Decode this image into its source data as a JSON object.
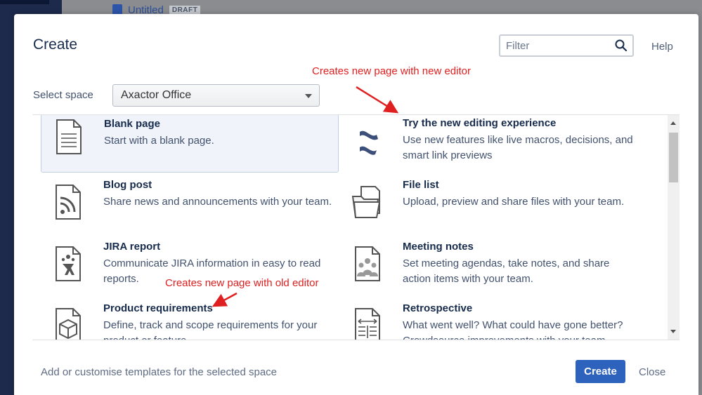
{
  "background": {
    "page_title": "Untitled",
    "page_badge": "DRAFT"
  },
  "dialog": {
    "title": "Create",
    "filter_placeholder": "Filter",
    "help_label": "Help",
    "select_space_label": "Select space",
    "selected_space": "Axactor Office",
    "templates": [
      {
        "name": "Blank page",
        "description": "Start with a blank page.",
        "icon": "blank-page-icon",
        "selected": true
      },
      {
        "name": "Try the new editing experience",
        "description": "Use new features like live macros, decisions, and smart link previews",
        "icon": "confluence-logo-icon"
      },
      {
        "name": "Blog post",
        "description": "Share news and announcements with your team.",
        "icon": "rss-icon"
      },
      {
        "name": "File list",
        "description": "Upload, preview and share files with your team.",
        "icon": "folder-icon"
      },
      {
        "name": "JIRA report",
        "description": "Communicate JIRA information in easy to read reports.",
        "icon": "jira-report-icon"
      },
      {
        "name": "Meeting notes",
        "description": "Set meeting agendas, take notes, and share action items with your team.",
        "icon": "meeting-notes-icon"
      },
      {
        "name": "Product requirements",
        "description": "Define, track and scope requirements for your product or feature.",
        "icon": "product-box-icon"
      },
      {
        "name": "Retrospective",
        "description": "What went well? What could have gone better? Crowdsource improvements with your team.",
        "icon": "retrospective-icon"
      }
    ],
    "footer_text": "Add or customise templates for the selected space",
    "create_label": "Create",
    "close_label": "Close"
  },
  "annotations": {
    "new_editor": "Creates new page with new editor",
    "old_editor": "Creates new page with old editor",
    "color": "#e02020"
  },
  "colors": {
    "primary_button": "#2d62bd",
    "selected_item_bg": "#f0f4fa"
  }
}
